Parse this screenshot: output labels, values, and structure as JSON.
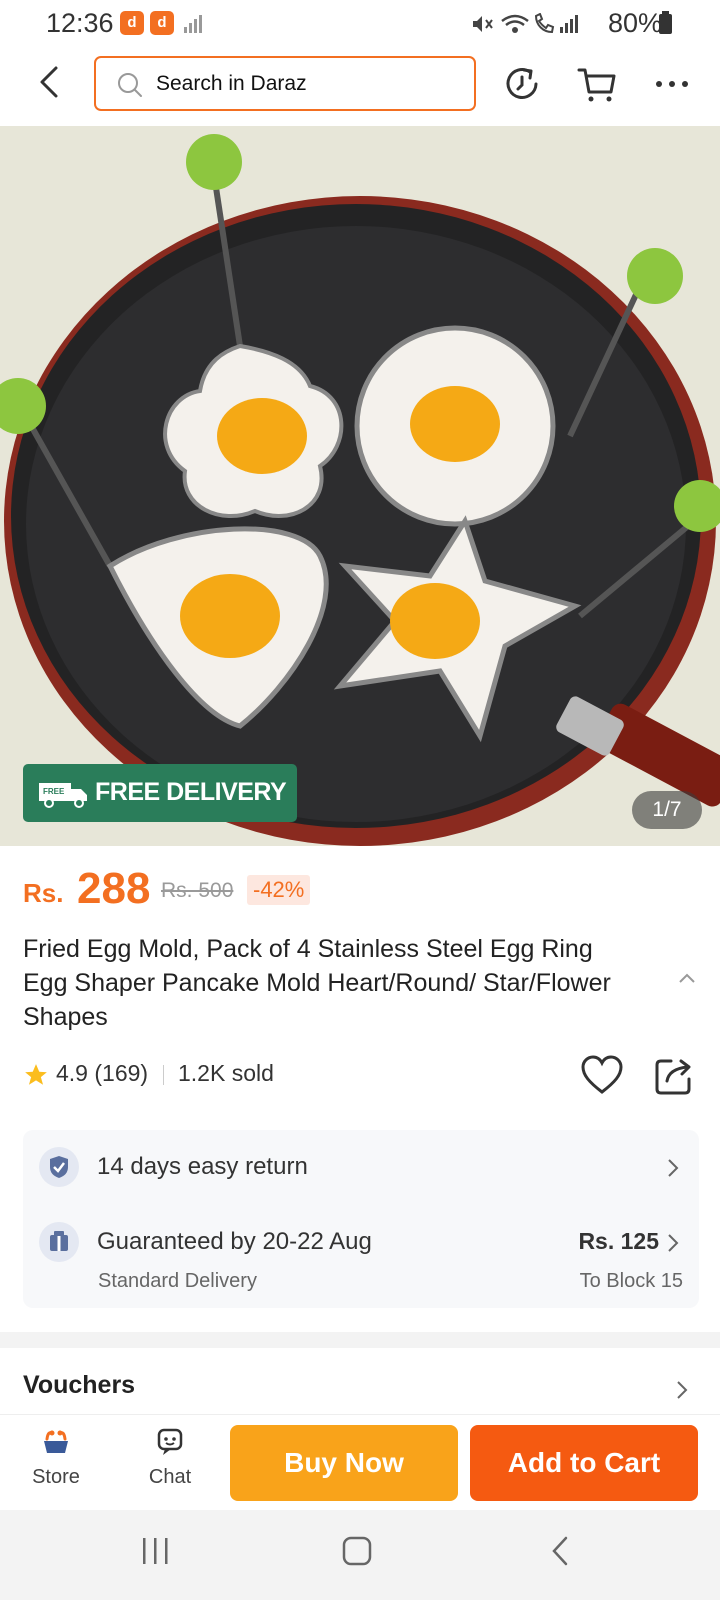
{
  "status_bar": {
    "time": "12:36",
    "notif_icons": [
      "daraz-app-icon",
      "daraz-app-icon"
    ],
    "battery": "80%"
  },
  "header": {
    "search_placeholder": "Search in Daraz",
    "icons": [
      "back-arrow-icon",
      "history-icon",
      "cart-icon",
      "more-icon"
    ]
  },
  "gallery": {
    "badge": "FREE DELIVERY",
    "badge_icon_text": "FREE",
    "counter": "1/7"
  },
  "product": {
    "currency": "Rs.",
    "price": "288",
    "original_price": "Rs. 500",
    "discount": "-42%",
    "title": "Fried Egg Mold, Pack of 4 Stainless Steel Egg Ring Egg Shaper Pancake Mold Heart/Round/ Star/Flower Shapes",
    "rating": "4.9 (169)",
    "sold": "1.2K sold"
  },
  "services": {
    "return": "14 days easy return",
    "delivery": "Guaranteed by 20-22 Aug",
    "delivery_type": "Standard Delivery",
    "delivery_fee": "Rs. 125",
    "destination": "To Block 15"
  },
  "vouchers": {
    "label": "Vouchers"
  },
  "bottom_bar": {
    "store": "Store",
    "chat": "Chat",
    "buy_now": "Buy Now",
    "add_to_cart": "Add to Cart"
  },
  "colors": {
    "accent": "#f36f21",
    "buy_now": "#f9a31a",
    "add_to_cart": "#f55a11",
    "free_delivery": "#2a7d5a"
  }
}
